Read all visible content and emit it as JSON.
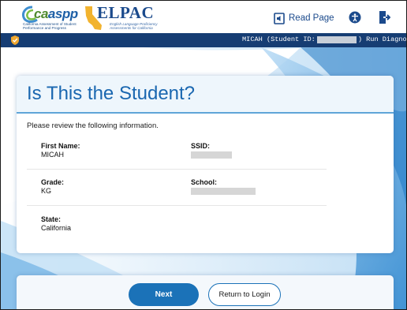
{
  "header": {
    "caaspp_word_a": "ca",
    "caaspp_word_b": "aspp",
    "caaspp_tagline": "California Assessment of Student Performance and Progress",
    "elpac_word": "ELPAC",
    "elpac_tagline": "English Language Proficiency Assessments for California",
    "read_page_label": "Read Page",
    "read_page_icon": "speaker-page-icon",
    "accessibility_icon": "accessibility-icon",
    "logout_icon": "logout-icon"
  },
  "session_bar": {
    "student_name_prefix": "MICAH (Student ID:",
    "student_suffix": ") Run Diagnostics",
    "shield_icon": "shield-check-icon"
  },
  "card": {
    "title": "Is This the Student?",
    "intro": "Please review the following information.",
    "fields": {
      "first_name": {
        "label": "First Name:",
        "value": "MICAH"
      },
      "ssid": {
        "label": "SSID:"
      },
      "grade": {
        "label": "Grade:",
        "value": "KG"
      },
      "school": {
        "label": "School:"
      },
      "state": {
        "label": "State:",
        "value": "California"
      }
    }
  },
  "buttons": {
    "next": "Next",
    "return_to_login": "Return to Login"
  },
  "colors": {
    "brand_blue": "#1b72b8",
    "bar_navy": "#163d73",
    "title_blue": "#1a67b0"
  }
}
